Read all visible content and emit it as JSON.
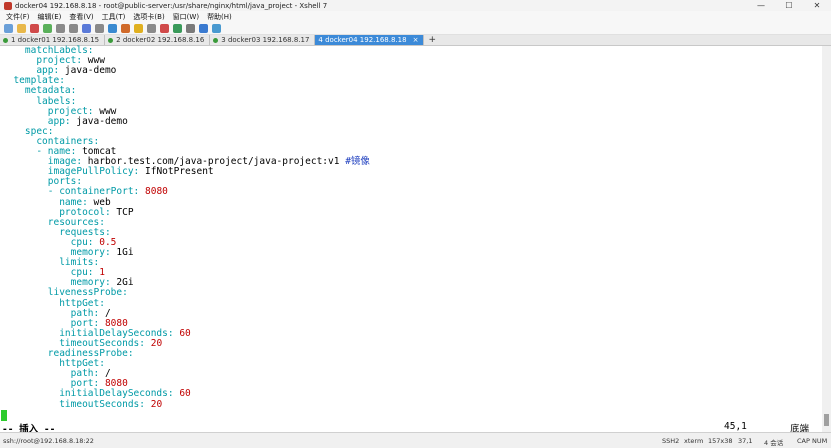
{
  "window": {
    "title": "docker04 192.168.8.18 - root@public-server:/usr/share/nginx/html/java_project - Xshell 7",
    "minimize": "—",
    "maximize": "☐",
    "close": "✕"
  },
  "menu": [
    "文件(F)",
    "编辑(E)",
    "查看(V)",
    "工具(T)",
    "选项卡(B)",
    "窗口(W)",
    "帮助(H)"
  ],
  "toolbar_icons": [
    "new-session-icon",
    "open-folder-icon",
    "disconnect-icon",
    "reconnect-icon",
    "copy-icon",
    "paste-icon",
    "find-icon",
    "print-icon",
    "globe-icon",
    "font-icon",
    "lock-icon",
    "keyboard-icon",
    "xftp-icon",
    "xmanager-icon",
    "layout-icon",
    "help-icon",
    "chat-icon"
  ],
  "tabs": [
    {
      "label": "1 docker01 192.168.8.15",
      "active": false
    },
    {
      "label": "2 docker02 192.168.8.16",
      "active": false
    },
    {
      "label": "3 docker03 192.168.8.17",
      "active": false
    },
    {
      "label": "4 docker04 192.168.8.18",
      "active": true
    }
  ],
  "tab_add": "+",
  "tab_close": "×",
  "terminal": {
    "lines": [
      [
        {
          "t": "    matchLabels:",
          "c": "k"
        }
      ],
      [
        {
          "t": "      project:",
          "c": "k"
        },
        {
          "t": " www",
          "c": "s"
        }
      ],
      [
        {
          "t": "      app:",
          "c": "k"
        },
        {
          "t": " java-demo",
          "c": "s"
        }
      ],
      [
        {
          "t": "  template:",
          "c": "k"
        }
      ],
      [
        {
          "t": "    metadata:",
          "c": "k"
        }
      ],
      [
        {
          "t": "      labels:",
          "c": "k"
        }
      ],
      [
        {
          "t": "        project:",
          "c": "k"
        },
        {
          "t": " www",
          "c": "s"
        }
      ],
      [
        {
          "t": "        app:",
          "c": "k"
        },
        {
          "t": " java-demo",
          "c": "s"
        }
      ],
      [
        {
          "t": "    spec:",
          "c": "k"
        }
      ],
      [
        {
          "t": "      containers:",
          "c": "k"
        }
      ],
      [
        {
          "t": "      - name:",
          "c": "k"
        },
        {
          "t": " tomcat",
          "c": "s"
        }
      ],
      [
        {
          "t": "        image:",
          "c": "k"
        },
        {
          "t": " harbor.test.com/java-project/java-project:v1 ",
          "c": "s"
        },
        {
          "t": "#镜像",
          "c": "c"
        }
      ],
      [
        {
          "t": "        imagePullPolicy:",
          "c": "k"
        },
        {
          "t": " IfNotPresent",
          "c": "s"
        }
      ],
      [
        {
          "t": "        ports:",
          "c": "k"
        }
      ],
      [
        {
          "t": "        - containerPort:",
          "c": "k"
        },
        {
          "t": " 8080",
          "c": "n"
        }
      ],
      [
        {
          "t": "          name:",
          "c": "k"
        },
        {
          "t": " web",
          "c": "s"
        }
      ],
      [
        {
          "t": "          protocol:",
          "c": "k"
        },
        {
          "t": " TCP",
          "c": "s"
        }
      ],
      [
        {
          "t": "        resources:",
          "c": "k"
        }
      ],
      [
        {
          "t": "          requests:",
          "c": "k"
        }
      ],
      [
        {
          "t": "            cpu:",
          "c": "k"
        },
        {
          "t": " 0.5",
          "c": "n"
        }
      ],
      [
        {
          "t": "            memory:",
          "c": "k"
        },
        {
          "t": " 1Gi",
          "c": "s"
        }
      ],
      [
        {
          "t": "          limits:",
          "c": "k"
        }
      ],
      [
        {
          "t": "            cpu:",
          "c": "k"
        },
        {
          "t": " 1",
          "c": "n"
        }
      ],
      [
        {
          "t": "            memory:",
          "c": "k"
        },
        {
          "t": " 2Gi",
          "c": "s"
        }
      ],
      [
        {
          "t": "        livenessProbe:",
          "c": "k"
        }
      ],
      [
        {
          "t": "          httpGet:",
          "c": "k"
        }
      ],
      [
        {
          "t": "            path:",
          "c": "k"
        },
        {
          "t": " /",
          "c": "s"
        }
      ],
      [
        {
          "t": "            port:",
          "c": "k"
        },
        {
          "t": " 8080",
          "c": "n"
        }
      ],
      [
        {
          "t": "          initialDelaySeconds:",
          "c": "k"
        },
        {
          "t": " 60",
          "c": "n"
        }
      ],
      [
        {
          "t": "          timeoutSeconds:",
          "c": "k"
        },
        {
          "t": " 20",
          "c": "n"
        }
      ],
      [
        {
          "t": "        readinessProbe:",
          "c": "k"
        }
      ],
      [
        {
          "t": "          httpGet:",
          "c": "k"
        }
      ],
      [
        {
          "t": "            path:",
          "c": "k"
        },
        {
          "t": " /",
          "c": "s"
        }
      ],
      [
        {
          "t": "            port:",
          "c": "k"
        },
        {
          "t": " 8080",
          "c": "n"
        }
      ],
      [
        {
          "t": "          initialDelaySeconds:",
          "c": "k"
        },
        {
          "t": " 60",
          "c": "n"
        }
      ],
      [
        {
          "t": "          timeoutSeconds:",
          "c": "k"
        },
        {
          "t": " 20",
          "c": "n"
        }
      ]
    ],
    "mode": "-- 插入 --",
    "cursor_position": "45,1",
    "scroll_position": "底端"
  },
  "statusbar": {
    "connection": "ssh://root@192.168.8.18:22",
    "protocol": "SSH2",
    "terminal_type": "xterm",
    "size": "157x38",
    "cursor": "37,1",
    "sessions": "4 会话",
    "keys": "CAP  NUM"
  },
  "colors": {
    "keyword": "#009aa6",
    "number": "#c00000",
    "comment": "#1f3fbf",
    "cursor": "#2ccb2c",
    "active_tab": "#3c8ad8"
  }
}
